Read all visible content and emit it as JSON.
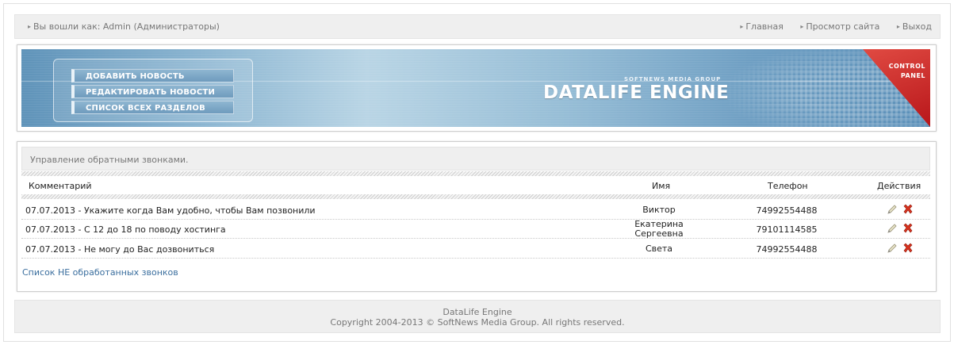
{
  "topbar": {
    "login_text": "Вы вошли как: Admin (Администраторы)",
    "nav": [
      "Главная",
      "Просмотр сайта",
      "Выход"
    ]
  },
  "banner": {
    "menu": [
      "ДОБАВИТЬ НОВОСТЬ",
      "РЕДАКТИРОВАТЬ НОВОСТИ",
      "СПИСОК ВСЕХ РАЗДЕЛОВ"
    ],
    "brand_sub": "SOFTNEWS MEDIA GROUP",
    "brand": "DATALIFE ENGINE",
    "corner_line1": "CONTROL",
    "corner_line2": "PANEL"
  },
  "main": {
    "heading": "Управление обратными звонками.",
    "columns": {
      "comment": "Комментарий",
      "name": "Имя",
      "phone": "Телефон",
      "actions": "Действия"
    },
    "rows": [
      {
        "comment": "07.07.2013 - Укажите когда Вам удобно, чтобы Вам позвонили",
        "name": "Виктор",
        "phone": "74992554488"
      },
      {
        "comment": "07.07.2013 - С 12 до 18 по поводу хостинга",
        "name": "Екатерина Сергеевна",
        "phone": "79101114585"
      },
      {
        "comment": "07.07.2013 - Не могу до Вас дозвониться",
        "name": "Света",
        "phone": "74992554488"
      }
    ],
    "link": "Список НЕ обработанных звонков"
  },
  "footer": {
    "line1": "DataLife Engine",
    "line2": "Copyright 2004-2013 © SoftNews Media Group. All rights reserved."
  },
  "icons": {
    "edit": "pencil-icon",
    "delete": "delete-x-icon"
  }
}
